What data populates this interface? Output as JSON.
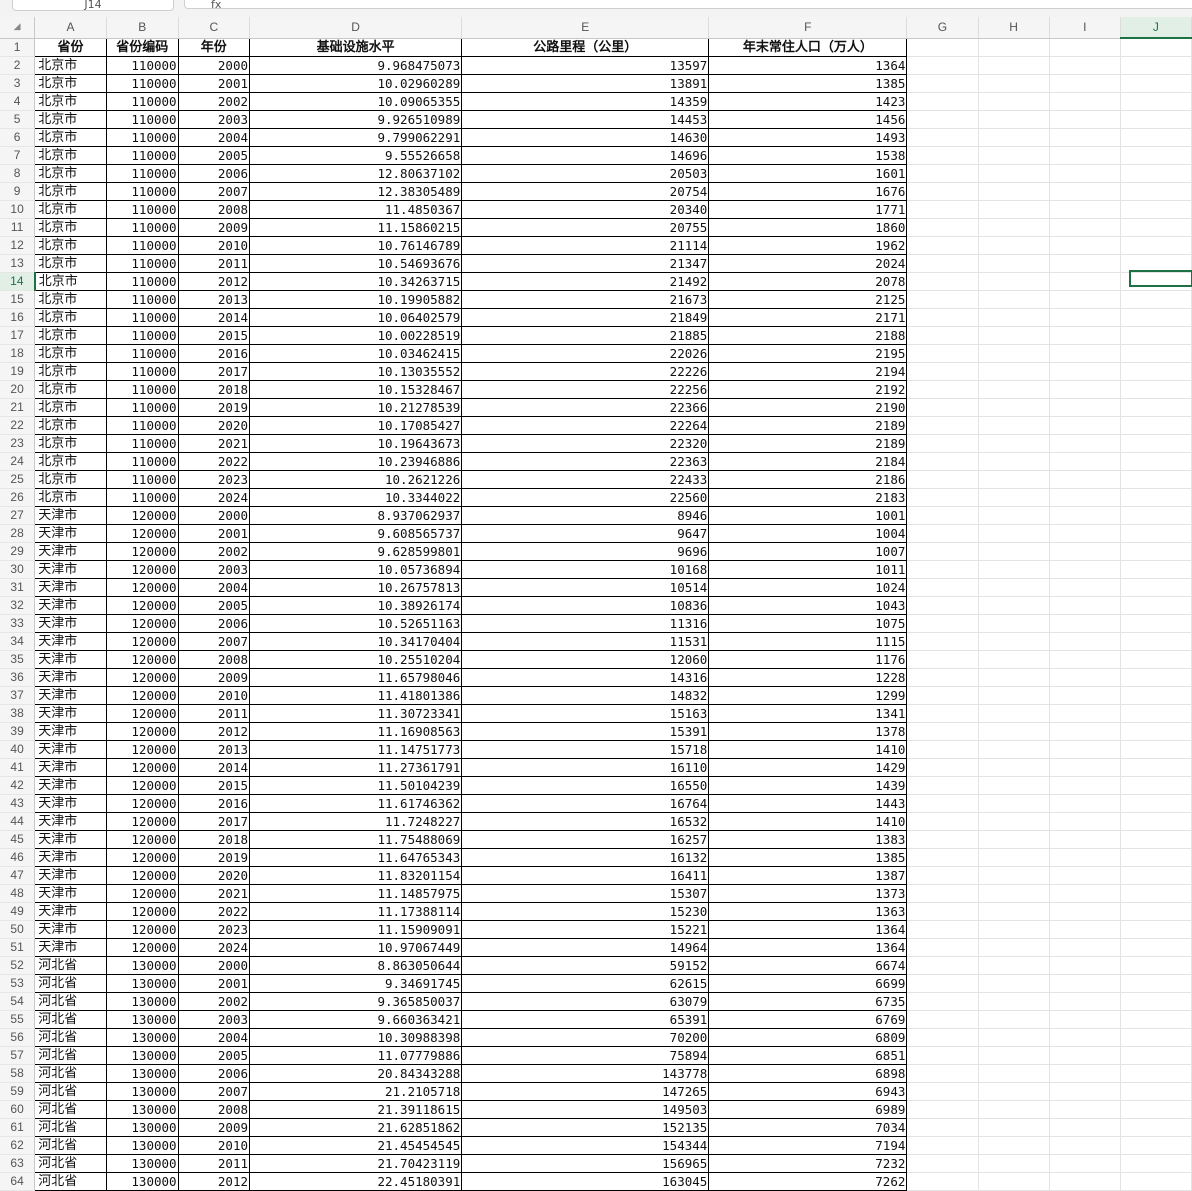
{
  "toolbar": {
    "name_box": "J14",
    "formula_icon": "fx"
  },
  "columns": [
    "A",
    "B",
    "C",
    "D",
    "E",
    "F",
    "G",
    "H",
    "I",
    "J"
  ],
  "selected_column": "J",
  "selected_row": 14,
  "header_row": [
    "省份",
    "省份编码",
    "年份",
    "基础设施水平",
    "公路里程（公里）",
    "年末常住人口（万人）"
  ],
  "rows": [
    [
      "北京市",
      "110000",
      "2000",
      "9.968475073",
      "13597",
      "1364"
    ],
    [
      "北京市",
      "110000",
      "2001",
      "10.02960289",
      "13891",
      "1385"
    ],
    [
      "北京市",
      "110000",
      "2002",
      "10.09065355",
      "14359",
      "1423"
    ],
    [
      "北京市",
      "110000",
      "2003",
      "9.926510989",
      "14453",
      "1456"
    ],
    [
      "北京市",
      "110000",
      "2004",
      "9.799062291",
      "14630",
      "1493"
    ],
    [
      "北京市",
      "110000",
      "2005",
      "9.55526658",
      "14696",
      "1538"
    ],
    [
      "北京市",
      "110000",
      "2006",
      "12.80637102",
      "20503",
      "1601"
    ],
    [
      "北京市",
      "110000",
      "2007",
      "12.38305489",
      "20754",
      "1676"
    ],
    [
      "北京市",
      "110000",
      "2008",
      "11.4850367",
      "20340",
      "1771"
    ],
    [
      "北京市",
      "110000",
      "2009",
      "11.15860215",
      "20755",
      "1860"
    ],
    [
      "北京市",
      "110000",
      "2010",
      "10.76146789",
      "21114",
      "1962"
    ],
    [
      "北京市",
      "110000",
      "2011",
      "10.54693676",
      "21347",
      "2024"
    ],
    [
      "北京市",
      "110000",
      "2012",
      "10.34263715",
      "21492",
      "2078"
    ],
    [
      "北京市",
      "110000",
      "2013",
      "10.19905882",
      "21673",
      "2125"
    ],
    [
      "北京市",
      "110000",
      "2014",
      "10.06402579",
      "21849",
      "2171"
    ],
    [
      "北京市",
      "110000",
      "2015",
      "10.00228519",
      "21885",
      "2188"
    ],
    [
      "北京市",
      "110000",
      "2016",
      "10.03462415",
      "22026",
      "2195"
    ],
    [
      "北京市",
      "110000",
      "2017",
      "10.13035552",
      "22226",
      "2194"
    ],
    [
      "北京市",
      "110000",
      "2018",
      "10.15328467",
      "22256",
      "2192"
    ],
    [
      "北京市",
      "110000",
      "2019",
      "10.21278539",
      "22366",
      "2190"
    ],
    [
      "北京市",
      "110000",
      "2020",
      "10.17085427",
      "22264",
      "2189"
    ],
    [
      "北京市",
      "110000",
      "2021",
      "10.19643673",
      "22320",
      "2189"
    ],
    [
      "北京市",
      "110000",
      "2022",
      "10.23946886",
      "22363",
      "2184"
    ],
    [
      "北京市",
      "110000",
      "2023",
      "10.2621226",
      "22433",
      "2186"
    ],
    [
      "北京市",
      "110000",
      "2024",
      "10.3344022",
      "22560",
      "2183"
    ],
    [
      "天津市",
      "120000",
      "2000",
      "8.937062937",
      "8946",
      "1001"
    ],
    [
      "天津市",
      "120000",
      "2001",
      "9.608565737",
      "9647",
      "1004"
    ],
    [
      "天津市",
      "120000",
      "2002",
      "9.628599801",
      "9696",
      "1007"
    ],
    [
      "天津市",
      "120000",
      "2003",
      "10.05736894",
      "10168",
      "1011"
    ],
    [
      "天津市",
      "120000",
      "2004",
      "10.26757813",
      "10514",
      "1024"
    ],
    [
      "天津市",
      "120000",
      "2005",
      "10.38926174",
      "10836",
      "1043"
    ],
    [
      "天津市",
      "120000",
      "2006",
      "10.52651163",
      "11316",
      "1075"
    ],
    [
      "天津市",
      "120000",
      "2007",
      "10.34170404",
      "11531",
      "1115"
    ],
    [
      "天津市",
      "120000",
      "2008",
      "10.25510204",
      "12060",
      "1176"
    ],
    [
      "天津市",
      "120000",
      "2009",
      "11.65798046",
      "14316",
      "1228"
    ],
    [
      "天津市",
      "120000",
      "2010",
      "11.41801386",
      "14832",
      "1299"
    ],
    [
      "天津市",
      "120000",
      "2011",
      "11.30723341",
      "15163",
      "1341"
    ],
    [
      "天津市",
      "120000",
      "2012",
      "11.16908563",
      "15391",
      "1378"
    ],
    [
      "天津市",
      "120000",
      "2013",
      "11.14751773",
      "15718",
      "1410"
    ],
    [
      "天津市",
      "120000",
      "2014",
      "11.27361791",
      "16110",
      "1429"
    ],
    [
      "天津市",
      "120000",
      "2015",
      "11.50104239",
      "16550",
      "1439"
    ],
    [
      "天津市",
      "120000",
      "2016",
      "11.61746362",
      "16764",
      "1443"
    ],
    [
      "天津市",
      "120000",
      "2017",
      "11.7248227",
      "16532",
      "1410"
    ],
    [
      "天津市",
      "120000",
      "2018",
      "11.75488069",
      "16257",
      "1383"
    ],
    [
      "天津市",
      "120000",
      "2019",
      "11.64765343",
      "16132",
      "1385"
    ],
    [
      "天津市",
      "120000",
      "2020",
      "11.83201154",
      "16411",
      "1387"
    ],
    [
      "天津市",
      "120000",
      "2021",
      "11.14857975",
      "15307",
      "1373"
    ],
    [
      "天津市",
      "120000",
      "2022",
      "11.17388114",
      "15230",
      "1363"
    ],
    [
      "天津市",
      "120000",
      "2023",
      "11.15909091",
      "15221",
      "1364"
    ],
    [
      "天津市",
      "120000",
      "2024",
      "10.97067449",
      "14964",
      "1364"
    ],
    [
      "河北省",
      "130000",
      "2000",
      "8.863050644",
      "59152",
      "6674"
    ],
    [
      "河北省",
      "130000",
      "2001",
      "9.34691745",
      "62615",
      "6699"
    ],
    [
      "河北省",
      "130000",
      "2002",
      "9.365850037",
      "63079",
      "6735"
    ],
    [
      "河北省",
      "130000",
      "2003",
      "9.660363421",
      "65391",
      "6769"
    ],
    [
      "河北省",
      "130000",
      "2004",
      "10.30988398",
      "70200",
      "6809"
    ],
    [
      "河北省",
      "130000",
      "2005",
      "11.07779886",
      "75894",
      "6851"
    ],
    [
      "河北省",
      "130000",
      "2006",
      "20.84343288",
      "143778",
      "6898"
    ],
    [
      "河北省",
      "130000",
      "2007",
      "21.2105718",
      "147265",
      "6943"
    ],
    [
      "河北省",
      "130000",
      "2008",
      "21.39118615",
      "149503",
      "6989"
    ],
    [
      "河北省",
      "130000",
      "2009",
      "21.62851862",
      "152135",
      "7034"
    ],
    [
      "河北省",
      "130000",
      "2010",
      "21.45454545",
      "154344",
      "7194"
    ],
    [
      "河北省",
      "130000",
      "2011",
      "21.70423119",
      "156965",
      "7232"
    ],
    [
      "河北省",
      "130000",
      "2012",
      "22.45180391",
      "163045",
      "7262"
    ]
  ]
}
